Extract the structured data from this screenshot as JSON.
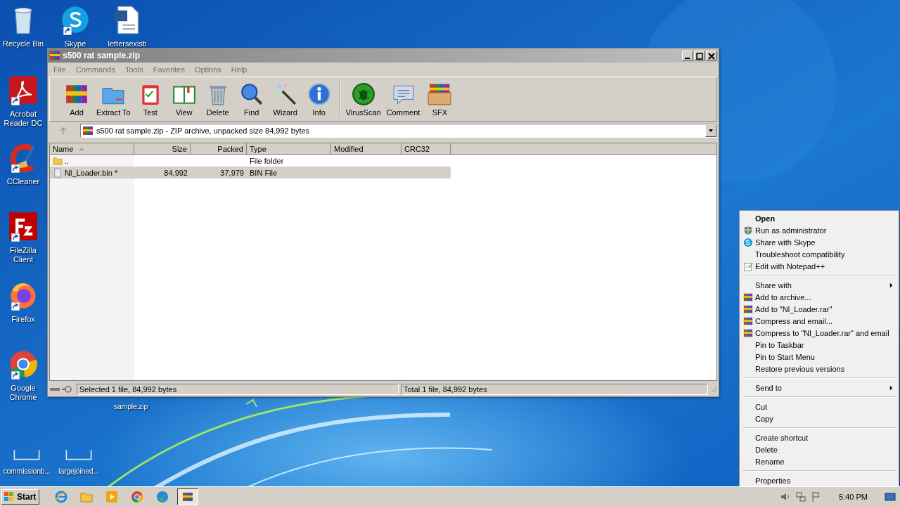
{
  "desktop_icons": [
    {
      "label": "Recycle Bin",
      "shortcut": false
    },
    {
      "label": "Skype",
      "shortcut": true
    },
    {
      "label": "lettersexisti",
      "shortcut": false
    },
    {
      "label": "Acrobat Reader DC",
      "shortcut": true
    },
    {
      "label": "CCleaner",
      "shortcut": true
    },
    {
      "label": "FileZilla Client",
      "shortcut": true
    },
    {
      "label": "Firefox",
      "shortcut": true
    },
    {
      "label": "Google Chrome",
      "shortcut": true
    },
    {
      "label": "commissionb...",
      "shortcut": false
    },
    {
      "label": "largejoined...",
      "shortcut": false
    },
    {
      "label": "sample.zip",
      "shortcut": false
    }
  ],
  "window": {
    "title": "s500 rat sample.zip",
    "active": false,
    "menu": [
      "File",
      "Commands",
      "Tools",
      "Favorites",
      "Options",
      "Help"
    ],
    "toolbar": [
      {
        "label": "Add"
      },
      {
        "label": "Extract To"
      },
      {
        "label": "Test"
      },
      {
        "label": "View"
      },
      {
        "label": "Delete"
      },
      {
        "label": "Find"
      },
      {
        "label": "Wizard"
      },
      {
        "label": "Info"
      },
      {
        "label": "VirusScan"
      },
      {
        "label": "Comment"
      },
      {
        "label": "SFX"
      }
    ],
    "address": "s500 rat sample.zip - ZIP archive, unpacked size 84,992 bytes",
    "columns": [
      {
        "label": "Name",
        "sorted": true
      },
      {
        "label": "Size",
        "sorted": false
      },
      {
        "label": "Packed",
        "sorted": false
      },
      {
        "label": "Type",
        "sorted": false
      },
      {
        "label": "Modified",
        "sorted": false
      },
      {
        "label": "CRC32",
        "sorted": false
      }
    ],
    "rows": [
      {
        "kind": "folder",
        "name": "..",
        "size": "",
        "packed": "",
        "type": "File folder",
        "selected": false
      },
      {
        "kind": "file",
        "name": "Nl_Loader.bin *",
        "size": "84,992",
        "packed": "37,979",
        "type": "BIN File",
        "selected": true
      }
    ],
    "status_left": "Selected 1 file, 84,992 bytes",
    "status_right": "Total 1 file, 84,992 bytes"
  },
  "context_menu": [
    {
      "kind": "item",
      "label": "Open",
      "default": true,
      "submenu": false
    },
    {
      "kind": "item",
      "label": "Run as administrator",
      "default": false,
      "submenu": false
    },
    {
      "kind": "item",
      "label": "Share with Skype",
      "default": false,
      "submenu": false
    },
    {
      "kind": "item",
      "label": "Troubleshoot compatibility",
      "default": false,
      "submenu": false
    },
    {
      "kind": "item",
      "label": "Edit with Notepad++",
      "default": false,
      "submenu": false
    },
    {
      "kind": "separator"
    },
    {
      "kind": "item",
      "label": "Share with",
      "default": false,
      "submenu": true
    },
    {
      "kind": "item",
      "label": "Add to archive...",
      "default": false,
      "submenu": false
    },
    {
      "kind": "item",
      "label": "Add to \"Nl_Loader.rar\"",
      "default": false,
      "submenu": false
    },
    {
      "kind": "item",
      "label": "Compress and email...",
      "default": false,
      "submenu": false
    },
    {
      "kind": "item",
      "label": "Compress to \"Nl_Loader.rar\" and email",
      "default": false,
      "submenu": false
    },
    {
      "kind": "item",
      "label": "Pin to Taskbar",
      "default": false,
      "submenu": false
    },
    {
      "kind": "item",
      "label": "Pin to Start Menu",
      "default": false,
      "submenu": false
    },
    {
      "kind": "item",
      "label": "Restore previous versions",
      "default": false,
      "submenu": false
    },
    {
      "kind": "separator"
    },
    {
      "kind": "item",
      "label": "Send to",
      "default": false,
      "submenu": true
    },
    {
      "kind": "separator"
    },
    {
      "kind": "item",
      "label": "Cut",
      "default": false,
      "submenu": false
    },
    {
      "kind": "item",
      "label": "Copy",
      "default": false,
      "submenu": false
    },
    {
      "kind": "separator"
    },
    {
      "kind": "item",
      "label": "Create shortcut",
      "default": false,
      "submenu": false
    },
    {
      "kind": "item",
      "label": "Delete",
      "default": false,
      "submenu": false
    },
    {
      "kind": "item",
      "label": "Rename",
      "default": false,
      "submenu": false
    },
    {
      "kind": "separator"
    },
    {
      "kind": "item",
      "label": "Properties",
      "default": false,
      "submenu": false
    }
  ],
  "taskbar": {
    "start": "Start",
    "apps": [
      {
        "active": false
      },
      {
        "active": false
      },
      {
        "active": false
      },
      {
        "active": false
      },
      {
        "active": false
      },
      {
        "active": true
      }
    ],
    "clock": "5:40 PM"
  }
}
